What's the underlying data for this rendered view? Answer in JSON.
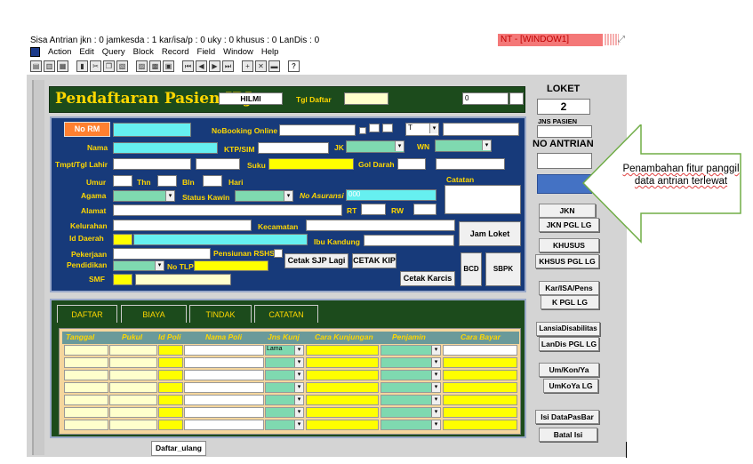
{
  "status_line": "Sisa Antrian jkn : 0 jamkesda : 1 kar/isa/p : 0 uky : 0 khusus : 0 LanDis : 0",
  "window_title": "NT - [WINDOW1]",
  "menu": [
    "Action",
    "Edit",
    "Query",
    "Block",
    "Record",
    "Field",
    "Window",
    "Help"
  ],
  "toolbar_help": "?",
  "header": {
    "title": "Pendaftaran Pasien IRJ",
    "user": "HILMI",
    "tgl_label": "Tgl Daftar",
    "field_value": "0"
  },
  "form": {
    "no_rm": "No RM",
    "nobooking": "NoBooking Online",
    "nama": "Nama",
    "ktp": "KTP/SIM",
    "jk": "JK",
    "wn": "WN",
    "tmpt": "Tmpt/Tgl Lahir",
    "suku": "Suku",
    "goldarah": "Gol Darah",
    "umur": "Umur",
    "thn": "Thn",
    "bln": "Bln",
    "hari": "Hari",
    "catatan": "Catatan",
    "agama": "Agama",
    "status_kawin": "Status Kawin",
    "no_asuransi": "No Asuransi",
    "asuransi_value": "000",
    "alamat": "Alamat",
    "rt": "RT",
    "rw": "RW",
    "kelurahan": "Kelurahan",
    "kecamatan": "Kecamatan",
    "id_daerah": "Id Daerah",
    "ibu_kandung": "Ibu Kandung",
    "jam_loket": "Jam Loket",
    "pekerjaan": "Pekerjaan",
    "pensiunan": "Pensiunan RSHS",
    "pendidikan": "Pendidikan",
    "no_tlp": "No TLP",
    "cetak_sjp": "Cetak SJP Lagi",
    "cetak_kip": "CETAK KIP",
    "bcd": "BCD",
    "sbpk": "SBPK",
    "smf": "SMF",
    "cetak_karcis": "Cetak Karcis",
    "t_value": "T"
  },
  "tabs": [
    "DAFTAR",
    "BIAYA",
    "TINDAK LANJUT",
    "CATATAN"
  ],
  "table": {
    "headers": [
      "Tanggal",
      "Pukul",
      "Id Poli",
      "Nama Poli",
      "Jns Kunj",
      "Cara Kunjungan",
      "Penjamin",
      "Cara Bayar"
    ],
    "first_jns": "Lama"
  },
  "sidebar": {
    "loket_label": "LOKET",
    "loket_value": "2",
    "jns_pasien": "JNS PASIEN",
    "no_antrian": "NO ANTRIAN",
    "buttons": [
      "JKN",
      "JKN PGL LG",
      "KHUSUS",
      "KHSUS PGL LG",
      "Kar/ISA/Pens",
      "K PGL LG",
      "LansiaDisabilitas",
      "LanDis PGL LG",
      "Um/Kon/Ya",
      "UmKoYa LG",
      "Isi DataPasBar",
      "Batal Isi"
    ]
  },
  "callout": "Penambahan fitur panggil data antrian terlewat",
  "footer_tab": "Daftar_ulang",
  "colors": {
    "header_bg": "#1c4b1c",
    "form_bg": "#173a7a",
    "label": "#ffd700",
    "no_rm": "#ff8030",
    "callout_border": "#70ad47"
  }
}
